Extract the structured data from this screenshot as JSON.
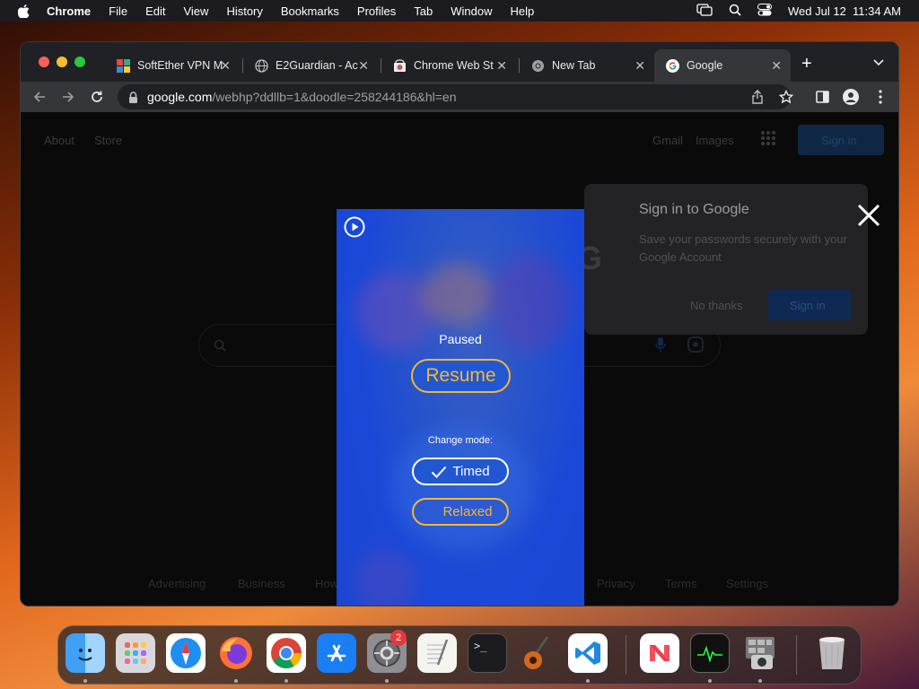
{
  "menubar": {
    "app": "Chrome",
    "items": [
      "File",
      "Edit",
      "View",
      "History",
      "Bookmarks",
      "Profiles",
      "Tab",
      "Window",
      "Help"
    ],
    "datetime": "Wed Jul 12  11:34 AM"
  },
  "tabs": [
    {
      "title": "SoftEther VPN M",
      "icon": "softether-icon"
    },
    {
      "title": "E2Guardian - Ac",
      "icon": "globe-icon"
    },
    {
      "title": "Chrome Web St",
      "icon": "chrome-web-store-icon"
    },
    {
      "title": "New Tab",
      "icon": "chrome-icon"
    },
    {
      "title": "Google",
      "icon": "google-icon",
      "active": true
    }
  ],
  "address": {
    "host": "google.com",
    "path": "/webhp?ddllb=1&doodle=258244186&hl=en"
  },
  "google_page": {
    "top_left": [
      "About",
      "Store"
    ],
    "top_right": [
      "Gmail",
      "Images"
    ],
    "sign_in_button": "Sign in",
    "panel": {
      "title": "Sign in to Google",
      "body": "Save your passwords securely with your Google Account",
      "no_thanks": "No thanks",
      "sign_in": "Sign in"
    },
    "footer_left": [
      "Advertising",
      "Business",
      "How Search works"
    ],
    "footer_right": [
      "Privacy",
      "Terms",
      "Settings"
    ]
  },
  "game": {
    "paused": "Paused",
    "resume": "Resume",
    "change_mode": "Change mode:",
    "timed": "Timed",
    "relaxed": "Relaxed"
  },
  "dock": {
    "settings_badge": "2"
  },
  "colors": {
    "accent_gold": "#f5b731",
    "game_blue": "#1a48d8"
  }
}
